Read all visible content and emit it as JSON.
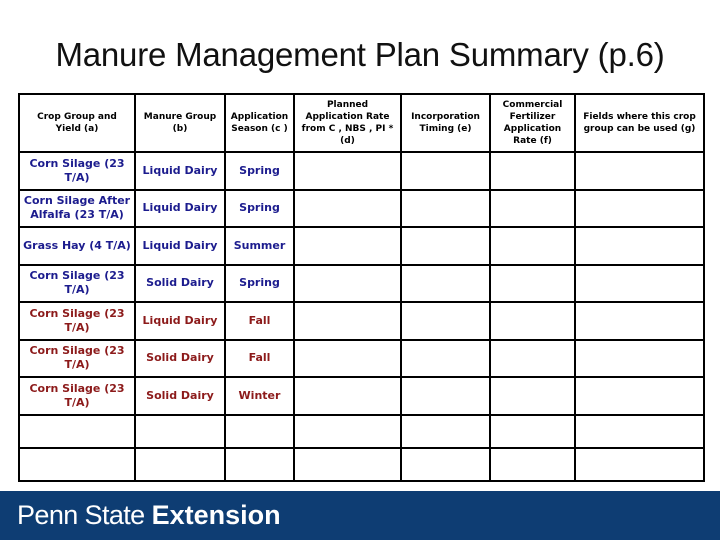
{
  "slide": {
    "title": "Manure Management Plan Summary (p.6)"
  },
  "table": {
    "headers": [
      "Crop Group and Yield (a)",
      "Manure Group (b)",
      "Application Season (c )",
      "Planned Application Rate from C , NBS , PI * (d)",
      "Incorporation Timing (e)",
      "Commercial Fertilizer Application Rate (f)",
      "Fields where this crop group can be used (g)"
    ],
    "rows": [
      {
        "color": "blue",
        "cells": [
          "Corn Silage (23 T/A)",
          "Liquid Dairy",
          "Spring",
          "",
          "",
          "",
          ""
        ]
      },
      {
        "color": "blue",
        "cells": [
          "Corn Silage After Alfalfa (23 T/A)",
          "Liquid Dairy",
          "Spring",
          "",
          "",
          "",
          ""
        ]
      },
      {
        "color": "blue",
        "cells": [
          "Grass Hay (4 T/A)",
          "Liquid Dairy",
          "Summer",
          "",
          "",
          "",
          ""
        ]
      },
      {
        "color": "blue",
        "cells": [
          "Corn Silage (23 T/A)",
          "Solid Dairy",
          "Spring",
          "",
          "",
          "",
          ""
        ]
      },
      {
        "color": "red",
        "cells": [
          "Corn Silage (23 T/A)",
          "Liquid Dairy",
          "Fall",
          "",
          "",
          "",
          ""
        ]
      },
      {
        "color": "red",
        "cells": [
          "Corn Silage (23 T/A)",
          "Solid Dairy",
          "Fall",
          "",
          "",
          "",
          ""
        ]
      },
      {
        "color": "red",
        "cells": [
          "Corn Silage (23 T/A)",
          "Solid Dairy",
          "Winter",
          "",
          "",
          "",
          ""
        ]
      },
      {
        "color": "empty",
        "cells": [
          "",
          "",
          "",
          "",
          "",
          "",
          ""
        ]
      },
      {
        "color": "empty",
        "cells": [
          "",
          "",
          "",
          "",
          "",
          "",
          ""
        ]
      }
    ],
    "colors": {
      "blue": "#1c1c8e",
      "red": "#8c1a1a"
    }
  },
  "footer": {
    "brand_light": "Penn State",
    "brand_bold": "Extension",
    "background": "#0e3d73"
  }
}
